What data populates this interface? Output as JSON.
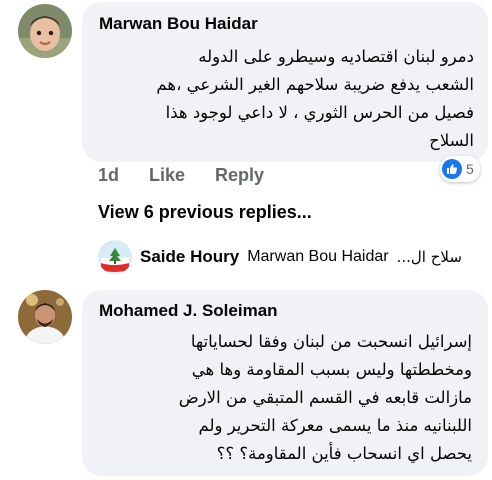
{
  "comment1": {
    "author": "Marwan Bou Haidar",
    "lines": [
      "دمرو لبنان اقتصاديه وسيطرو على الدوله",
      "الشعب يدفع ضريبة سلاحهم الغير الشرعي ،هم",
      "فصيل من الحرس الثوري ، لا داعي لوجود هذا",
      "السلاح"
    ],
    "time": "1d",
    "like_label": "Like",
    "reply_label": "Reply",
    "reaction_count": "5"
  },
  "view_replies": "View 6 previous replies...",
  "reply_preview": {
    "name": "Saide Houry",
    "snippet": "Marwan Bou Haidar",
    "rtl_text": "سلاح ال..."
  },
  "comment2": {
    "author": "Mohamed J. Soleiman",
    "lines": [
      "إسرائيل انسحبت من لبنان وفقا لحساياتها",
      "ومخططتها وليس بسبب المقاومة وها هي",
      "مازالت قابعه في القسم المتبقي من الارض",
      "اللبنانيه منذ ما يسمى معركة التحرير ولم",
      "يحصل اي انسحاب فأين المقاومة؟ ؟؟"
    ]
  },
  "colors": {
    "bubble": "#f0f2f5",
    "meta": "#65676b",
    "like_blue": "#1877f2"
  },
  "icons": [
    "avatar-child-icon",
    "like-thumb-icon",
    "lebanon-flag-avatar-icon",
    "avatar-man-icon"
  ]
}
